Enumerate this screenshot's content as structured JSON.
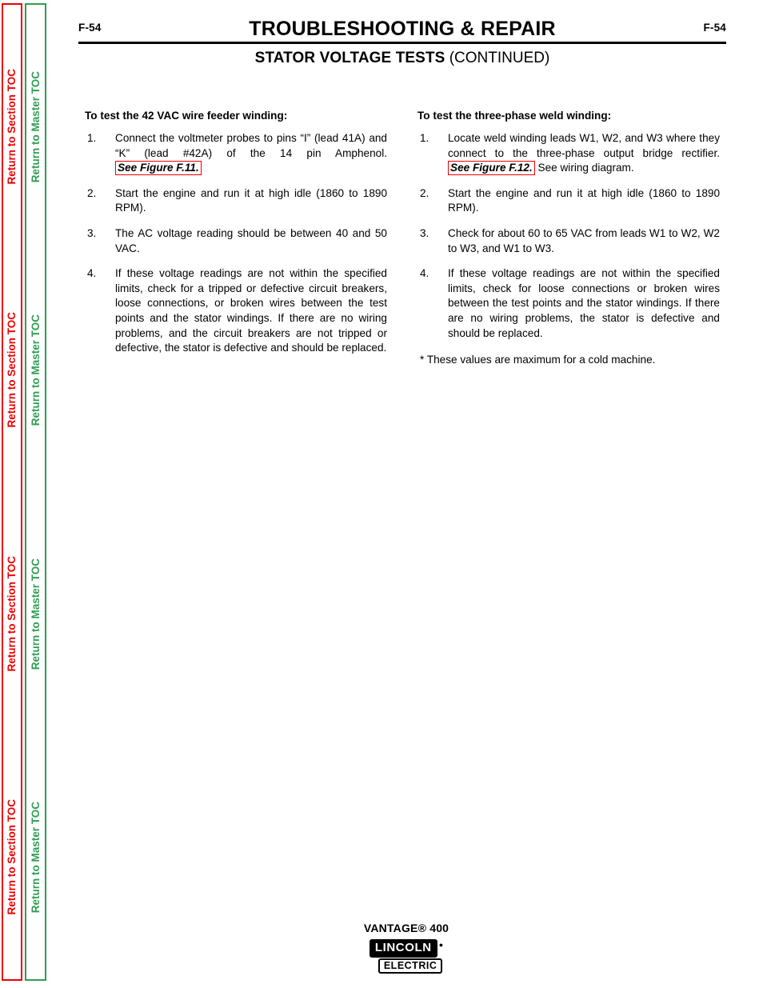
{
  "sidebar": {
    "section_toc_label": "Return to Section TOC",
    "master_toc_label": "Return to Master TOC",
    "repeat_count": 4,
    "section_color": "#ee0000",
    "master_color": "#2f9e52"
  },
  "header": {
    "folio_left": "F-54",
    "folio_right": "F-54",
    "main_title": "TROUBLESHOOTING & REPAIR",
    "subtitle_strong": "STATOR VOLTAGE TESTS",
    "subtitle_plain": " (CONTINUED)"
  },
  "left_column": {
    "heading": "To test the 42 VAC wire feeder winding:",
    "steps": [
      {
        "number": "1.",
        "text_before": "Connect the voltmeter probes to pins “I” (lead 41A) and “K” (lead #42A) of the 14 pin Amphenol. ",
        "figure_ref": "See Figure F.11.",
        "text_after": ""
      },
      {
        "number": "2.",
        "text_before": "Start the engine and run it at high idle (1860 to 1890 RPM).",
        "figure_ref": "",
        "text_after": ""
      },
      {
        "number": "3.",
        "text_before": "The AC voltage reading should be between 40 and 50 VAC.",
        "figure_ref": "",
        "text_after": ""
      },
      {
        "number": "4.",
        "text_before": "If these voltage readings are not within the specified limits, check for a tripped or defective circuit breakers, loose connections, or broken wires between the test points and the stator windings.  If there are no wiring problems, and the circuit breakers are not tripped or defective, the stator is defective and should be replaced.",
        "figure_ref": "",
        "text_after": ""
      }
    ]
  },
  "right_column": {
    "heading": "To test the three-phase weld winding:",
    "steps": [
      {
        "number": "1.",
        "text_before": "Locate weld winding leads W1, W2, and W3 where they connect to the three-phase output bridge rectifier. ",
        "figure_ref": "See Figure F.12.",
        "text_after": " See wiring diagram."
      },
      {
        "number": "2.",
        "text_before": "Start the engine and run it at high idle (1860 to 1890 RPM).",
        "figure_ref": "",
        "text_after": ""
      },
      {
        "number": "3.",
        "text_before": "Check for about 60 to 65 VAC from leads W1 to W2, W2 to W3, and W1 to W3.",
        "figure_ref": "",
        "text_after": ""
      },
      {
        "number": "4.",
        "text_before": "If these voltage readings are not within the specified limits, check for loose connections or broken wires between the test points and the stator windings.  If there are no wiring problems, the stator is defective and should be replaced.",
        "figure_ref": "",
        "text_after": ""
      }
    ],
    "footnote": "* These values are maximum for a cold machine."
  },
  "footer": {
    "product": "VANTAGE® 400",
    "logo_primary": "LINCOLN",
    "logo_registered": "●",
    "logo_secondary": "ELECTRIC"
  }
}
